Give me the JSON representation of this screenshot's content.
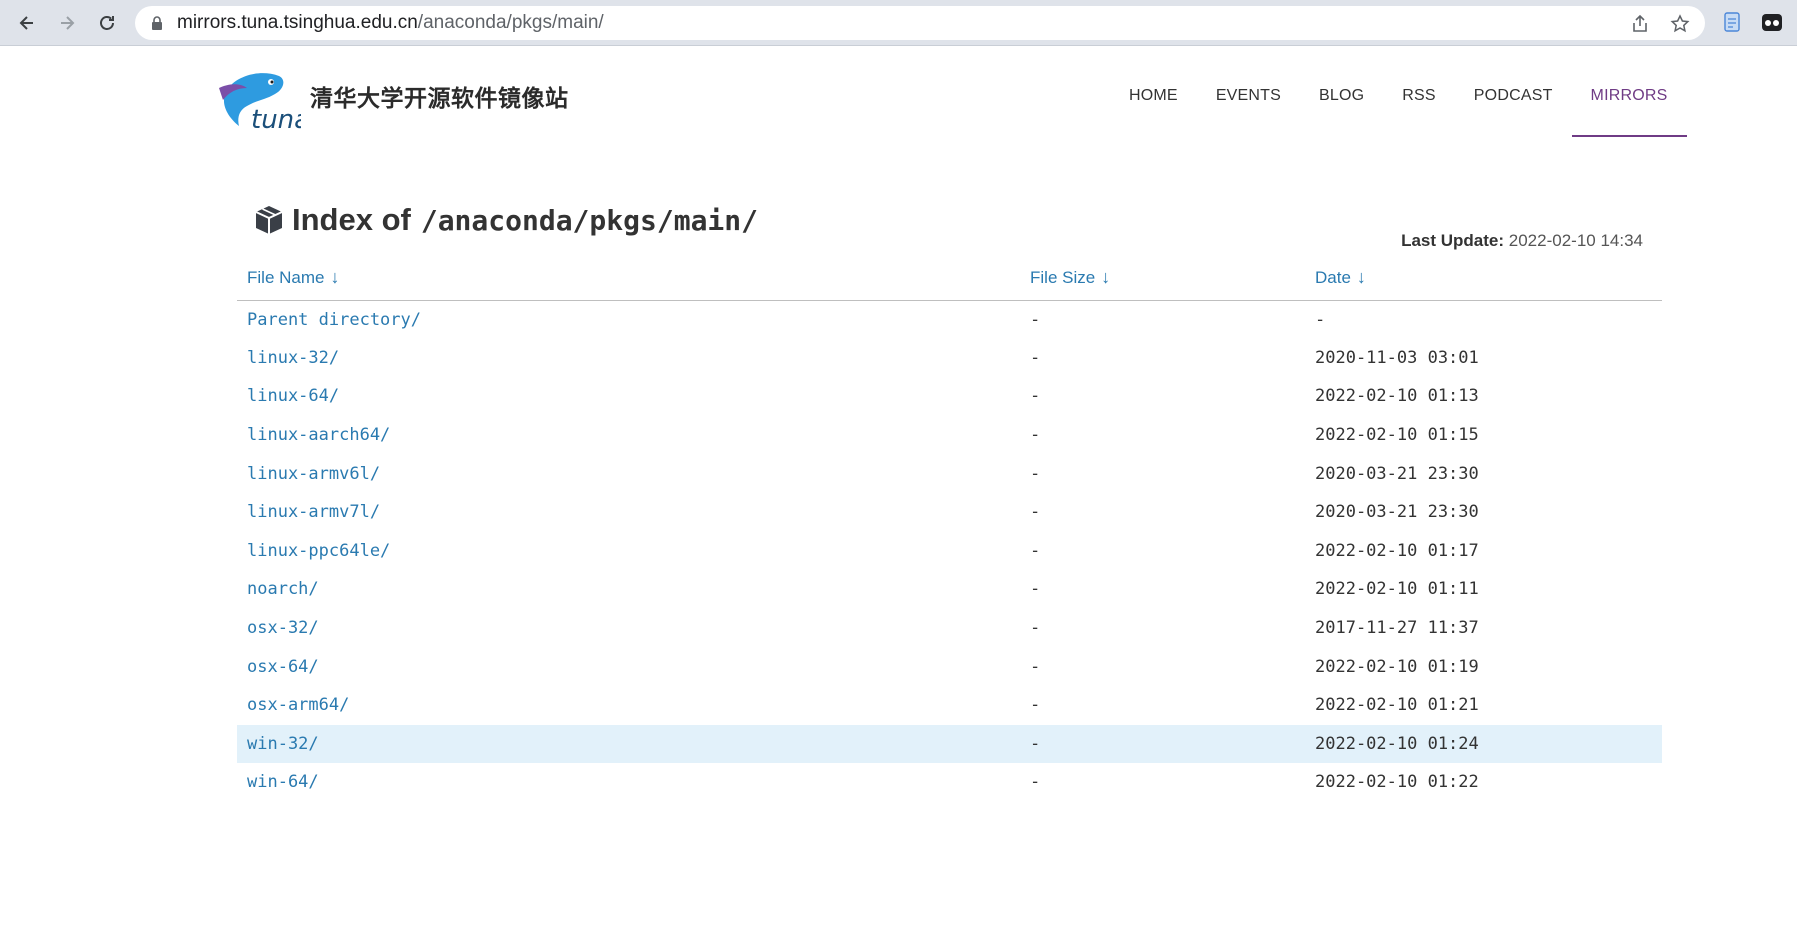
{
  "browser": {
    "url_host": "mirrors.tuna.tsinghua.edu.cn",
    "url_path": "/anaconda/pkgs/main/"
  },
  "site": {
    "logo_text": "tuna",
    "title": "清华大学开源软件镜像站",
    "nav": [
      "HOME",
      "EVENTS",
      "BLOG",
      "RSS",
      "PODCAST",
      "MIRRORS"
    ],
    "active_nav": "MIRRORS",
    "accent_color": "#6f3b85",
    "link_color": "#2a7ab0"
  },
  "page": {
    "title_prefix": "Index of",
    "title_path": "/anaconda/pkgs/main/",
    "last_update_label": "Last Update:",
    "last_update_value": "2022-02-10 14:34"
  },
  "table": {
    "headers": [
      "File Name",
      "File Size",
      "Date"
    ],
    "sort_arrow": "↓",
    "rows": [
      {
        "name": "Parent directory/",
        "size": "-",
        "date": "-"
      },
      {
        "name": "linux-32/",
        "size": "-",
        "date": "2020-11-03 03:01"
      },
      {
        "name": "linux-64/",
        "size": "-",
        "date": "2022-02-10 01:13"
      },
      {
        "name": "linux-aarch64/",
        "size": "-",
        "date": "2022-02-10 01:15"
      },
      {
        "name": "linux-armv6l/",
        "size": "-",
        "date": "2020-03-21 23:30"
      },
      {
        "name": "linux-armv7l/",
        "size": "-",
        "date": "2020-03-21 23:30"
      },
      {
        "name": "linux-ppc64le/",
        "size": "-",
        "date": "2022-02-10 01:17"
      },
      {
        "name": "noarch/",
        "size": "-",
        "date": "2022-02-10 01:11"
      },
      {
        "name": "osx-32/",
        "size": "-",
        "date": "2017-11-27 11:37"
      },
      {
        "name": "osx-64/",
        "size": "-",
        "date": "2022-02-10 01:19"
      },
      {
        "name": "osx-arm64/",
        "size": "-",
        "date": "2022-02-10 01:21"
      },
      {
        "name": "win-32/",
        "size": "-",
        "date": "2022-02-10 01:24"
      },
      {
        "name": "win-64/",
        "size": "-",
        "date": "2022-02-10 01:22"
      }
    ],
    "highlighted_row": 11
  }
}
